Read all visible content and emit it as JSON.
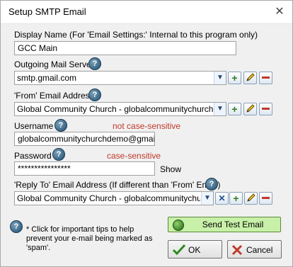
{
  "window": {
    "title": "Setup SMTP Email",
    "close_glyph": "✕"
  },
  "display_name": {
    "label": "Display Name (For 'Email Settings:' Internal  to this program only)",
    "value": "GCC Main"
  },
  "outgoing_server": {
    "label": "Outgoing Mail Server",
    "value": "smtp.gmail.com"
  },
  "from_address": {
    "label": "'From' Email Address",
    "value": "Global Community Church - globalcommunitychurchdemo..."
  },
  "username": {
    "label": "Username",
    "note": "not case-sensitive",
    "value": "globalcommunitychurchdemo@gmail.com"
  },
  "password": {
    "label": "Password",
    "note": "case-sensitive",
    "value": "****************",
    "show_label": "Show"
  },
  "reply_to": {
    "label": "'Reply To' Email Address (If different than 'From' Email)",
    "value": "Global Community Church - globalcommunitychurchd..."
  },
  "help_glyph": "?",
  "dropdown_glyph": "▼",
  "plus_glyph": "+",
  "x_glyph": "✕",
  "tip_text": "* Click for important tips to help prevent your e-mail being marked as 'spam'.",
  "buttons": {
    "send_test": "Send Test Email",
    "ok": "OK",
    "cancel": "Cancel"
  },
  "colors": {
    "red_text": "#c0392b",
    "send_green": "#c8f0a8"
  }
}
